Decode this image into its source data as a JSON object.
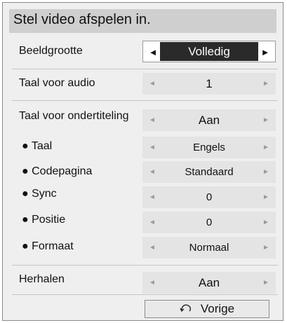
{
  "title": "Stel video afspelen in.",
  "rows": [
    {
      "label": "Beeldgrootte",
      "value": "Volledig"
    },
    {
      "label": "Taal voor audio",
      "value": "1"
    },
    {
      "label": "Taal voor ondertiteling",
      "value": "Aan"
    },
    {
      "label": "● Taal",
      "value": "Engels"
    },
    {
      "label": "● Codepagina",
      "value": "Standaard"
    },
    {
      "label": "● Sync",
      "value": "0"
    },
    {
      "label": "● Positie",
      "value": "0"
    },
    {
      "label": "● Formaat",
      "value": "Normaal"
    },
    {
      "label": "Herhalen",
      "value": "Aan"
    }
  ],
  "arrows": {
    "left": "◄",
    "right": "►"
  },
  "back_button": {
    "icon": "return-arrow-icon",
    "label": "Vorige"
  }
}
